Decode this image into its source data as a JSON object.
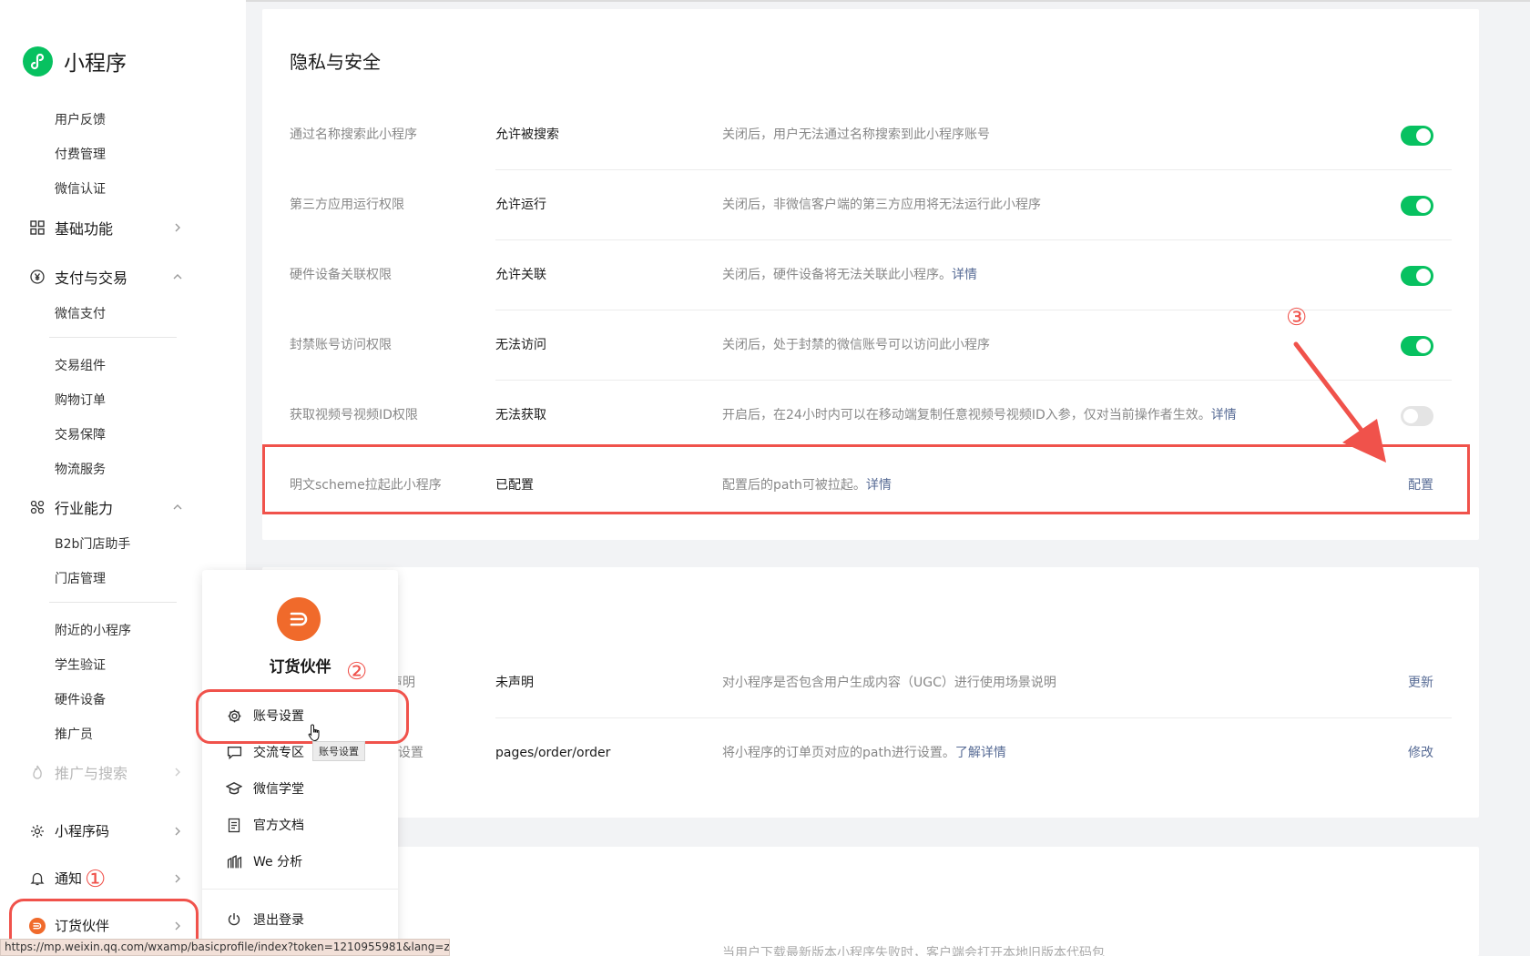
{
  "app": {
    "name": "小程序",
    "brand_color": "#07c160",
    "accent_red": "#f0524b",
    "link_color": "#576b95"
  },
  "sidebar": {
    "top_items": [
      "用户反馈",
      "付费管理",
      "微信认证"
    ],
    "sections": [
      {
        "label": "基础功能",
        "icon": "grid-icon",
        "chevron": "right"
      },
      {
        "label": "支付与交易",
        "icon": "yuan-circle-icon",
        "chevron": "up"
      },
      {
        "label": "行业能力",
        "icon": "nodes-icon",
        "chevron": "up"
      },
      {
        "label": "推广与搜索",
        "icon": "flame-icon",
        "chevron": "right"
      },
      {
        "label": "小程序码",
        "icon": "sun-icon",
        "chevron": "right"
      },
      {
        "label": "通知",
        "icon": "bell-icon",
        "chevron": "right"
      },
      {
        "label": "订货伙伴",
        "icon": "partner-avatar-icon",
        "chevron": "right"
      }
    ],
    "payment_items": [
      "微信支付",
      "交易组件",
      "购物订单",
      "交易保障",
      "物流服务"
    ],
    "industry_items": [
      "B2b门店助手",
      "门店管理",
      "附近的小程序",
      "学生验证",
      "硬件设备",
      "推广员"
    ]
  },
  "privacy": {
    "title": "隐私与安全",
    "rows": [
      {
        "name": "通过名称搜索此小程序",
        "status": "允许被搜索",
        "desc": "关闭后，用户无法通过名称搜索到此小程序账号",
        "link": "",
        "toggle": "on"
      },
      {
        "name": "第三方应用运行权限",
        "status": "允许运行",
        "desc": "关闭后，非微信客户端的第三方应用将无法运行此小程序",
        "link": "",
        "toggle": "on"
      },
      {
        "name": "硬件设备关联权限",
        "status": "允许关联",
        "desc": "关闭后，硬件设备将无法关联此小程序。",
        "link": "详情",
        "toggle": "on"
      },
      {
        "name": "封禁账号访问权限",
        "status": "无法访问",
        "desc": "关闭后，处于封禁的微信账号可以访问此小程序",
        "link": "",
        "toggle": "on"
      },
      {
        "name": "获取视频号视频ID权限",
        "status": "无法获取",
        "desc": "开启后，在24小时内可以在移动端复制任意视频号视频ID入参，仅对当前操作者生效。",
        "link": "详情",
        "toggle": "off"
      },
      {
        "name": "明文scheme拉起此小程序",
        "status": "已配置",
        "desc": "配置后的path可被拉起。",
        "link": "详情",
        "action": "配置"
      }
    ]
  },
  "second_card": {
    "rows": [
      {
        "name_tail": "声明",
        "status": "未声明",
        "desc": "对小程序是否包含用户生成内容（UGC）进行使用场景说明",
        "link": "",
        "action": "更新"
      },
      {
        "name_tail": "h设置",
        "status": "pages/order/order",
        "desc": "将小程序的订单页对应的path进行设置。",
        "link": "了解详情",
        "action": "修改"
      }
    ]
  },
  "third_card": {
    "desc": "当用户下载最新版本小程序失败时，客户端会打开本地旧版本代码包"
  },
  "popup": {
    "account_name": "订货伙伴",
    "items": [
      {
        "label": "账号设置",
        "icon": "gear-icon"
      },
      {
        "label": "交流专区",
        "icon": "chat-icon"
      },
      {
        "label": "微信学堂",
        "icon": "graduation-cap-icon"
      },
      {
        "label": "官方文档",
        "icon": "document-icon"
      },
      {
        "label": "We 分析",
        "icon": "analytics-icon"
      }
    ],
    "logout": "退出登录",
    "tooltip": "账号设置"
  },
  "markers": [
    "①",
    "②",
    "③"
  ],
  "statusbar_url": "https://mp.weixin.qq.com/wxamp/basicprofile/index?token=1210955981&lang=zh_CN"
}
